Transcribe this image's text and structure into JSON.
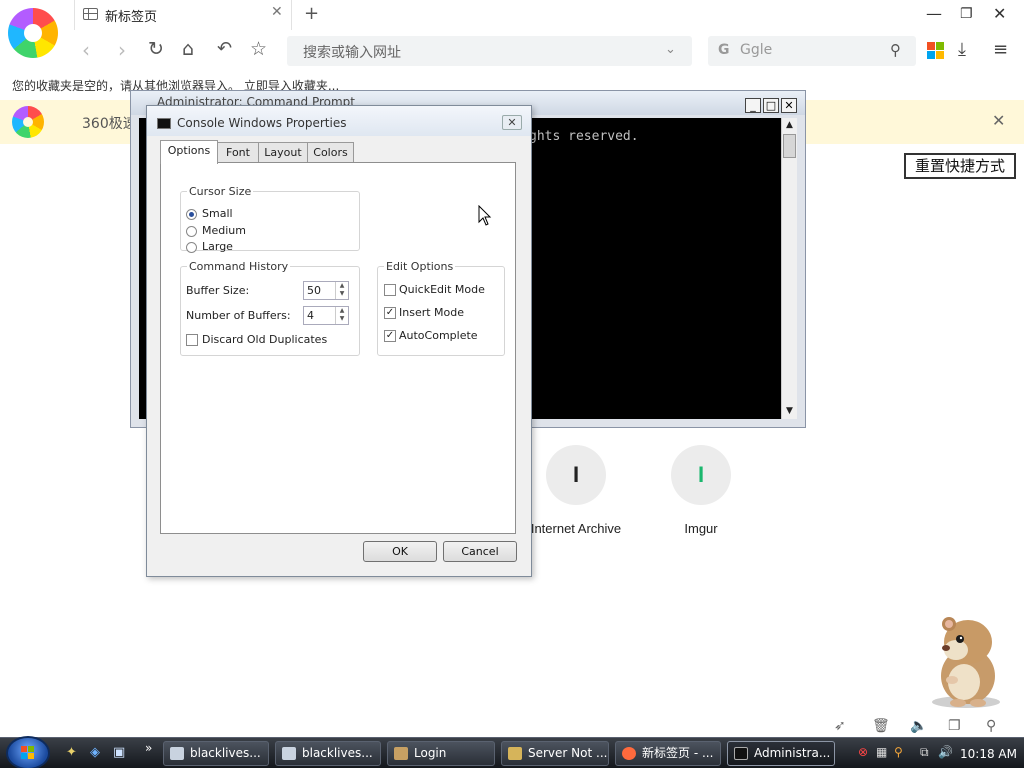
{
  "browser": {
    "tab": {
      "title": "新标签页"
    },
    "address": {
      "placeholder": "搜索或输入网址"
    },
    "search": {
      "engine_letter": "G",
      "placeholder": "Ggle"
    },
    "bookmark_bar_text": "您的收藏夹是空的，请从其他浏览器导入。 立即导入收藏夹...",
    "notice_text": "360极速",
    "reset_shortcuts_label": "重置快捷方式",
    "tiles": [
      {
        "letter": "I",
        "label": "Internet Archive",
        "color": "#222222"
      },
      {
        "letter": "I",
        "label": "Imgur",
        "color": "#1bb76e"
      }
    ]
  },
  "console": {
    "title": "Administrator: Command Prompt",
    "visible_text": "ghts reserved."
  },
  "dialog": {
    "title": "Console Windows Properties",
    "tabs": [
      "Options",
      "Font",
      "Layout",
      "Colors"
    ],
    "active_tab": "Options",
    "cursor_size": {
      "legend": "Cursor Size",
      "options": [
        "Small",
        "Medium",
        "Large"
      ],
      "selected": "Small"
    },
    "command_history": {
      "legend": "Command History",
      "buffer_size_label": "Buffer Size:",
      "buffer_size_value": "50",
      "number_of_buffers_label": "Number of Buffers:",
      "number_of_buffers_value": "4",
      "discard_label": "Discard Old Duplicates",
      "discard_checked": false
    },
    "edit_options": {
      "legend": "Edit Options",
      "quickedit_label": "QuickEdit Mode",
      "quickedit_checked": false,
      "insert_label": "Insert Mode",
      "insert_checked": true,
      "autocomplete_label": "AutoComplete",
      "autocomplete_checked": true
    },
    "ok_label": "OK",
    "cancel_label": "Cancel"
  },
  "taskbar": {
    "tasks": [
      {
        "label": "blacklives...",
        "icon_color": "#c9d3e0"
      },
      {
        "label": "blacklives...",
        "icon_color": "#c9d3e0"
      },
      {
        "label": "Login",
        "icon_color": "#c7a063"
      },
      {
        "label": "Server Not ...",
        "icon_color": "#d6b45a"
      },
      {
        "label": "新标签页 - ...",
        "icon_color": "#ff6a3d"
      },
      {
        "label": "Administra...",
        "icon_color": "#111111"
      }
    ],
    "clock": "10:18 AM"
  }
}
